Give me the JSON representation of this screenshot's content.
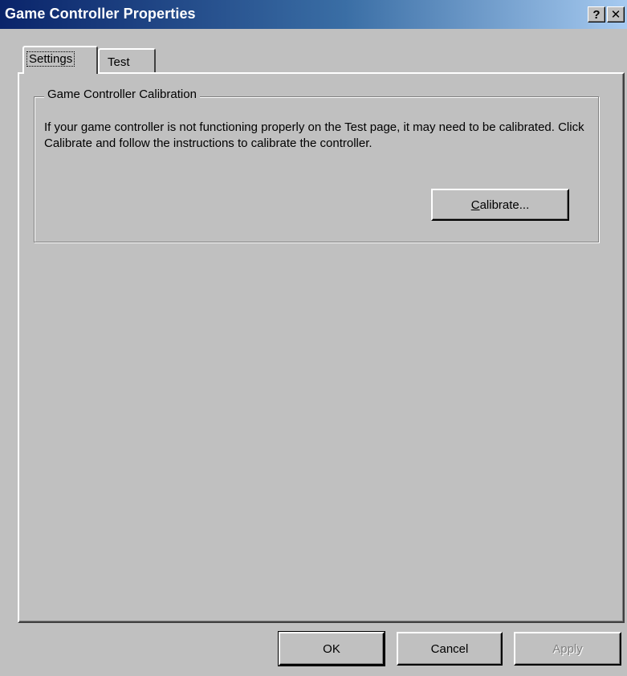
{
  "window": {
    "title": "Game Controller Properties",
    "help_glyph": "?",
    "close_glyph": "✕"
  },
  "tabs": [
    {
      "label": "Settings",
      "selected": true
    },
    {
      "label": "Test",
      "selected": false
    }
  ],
  "calibration": {
    "group_title": "Game Controller Calibration",
    "description": "If your game controller is not functioning properly on the Test page, it may need to be calibrated.  Click Calibrate and follow the instructions to calibrate the controller.",
    "calibrate_mnemonic": "C",
    "calibrate_rest": "alibrate..."
  },
  "footer": {
    "ok_label": "OK",
    "cancel_label": "Cancel",
    "apply_label": "Apply",
    "apply_enabled": false
  },
  "colors": {
    "dialog_face": "#c0c0c0",
    "titlebar_start": "#0a246a",
    "titlebar_end": "#a6caf0",
    "disabled_text": "#808080"
  },
  "icons": [
    "help-icon",
    "close-icon"
  ]
}
